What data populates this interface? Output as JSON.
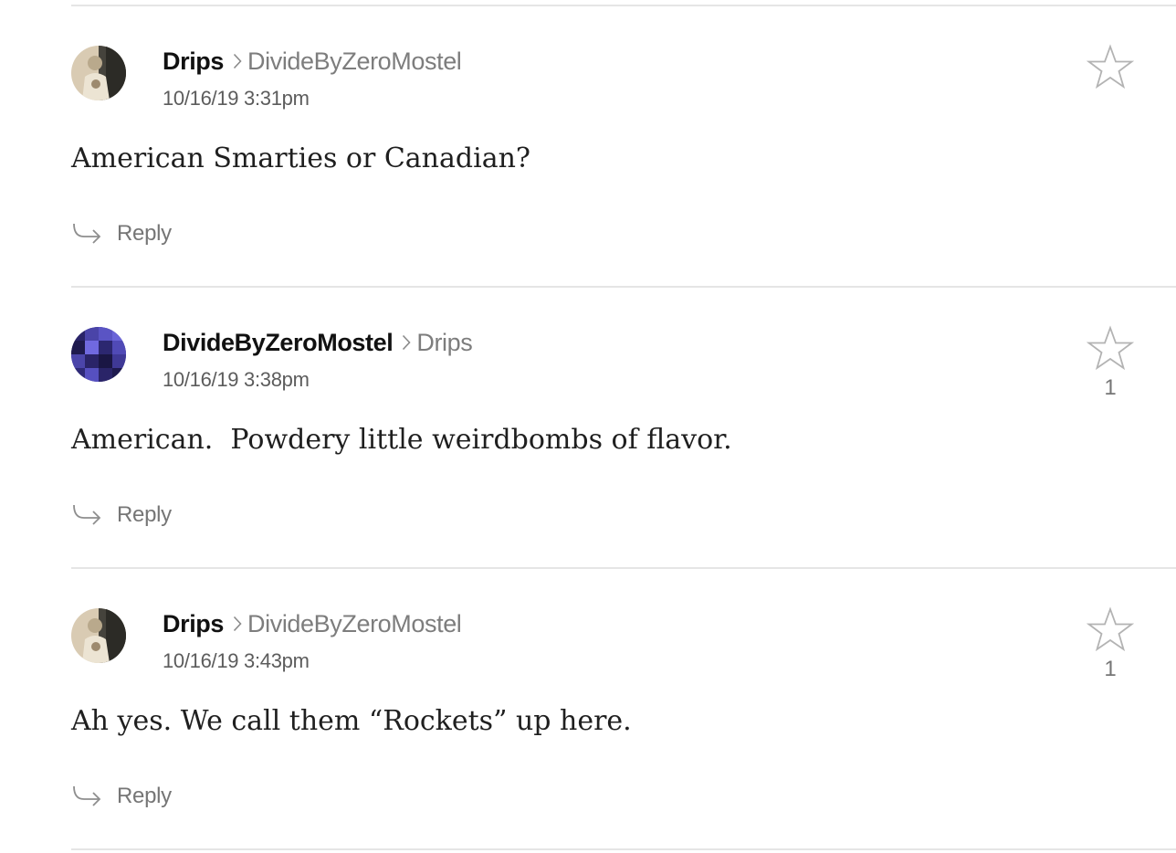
{
  "comments": [
    {
      "author": "Drips",
      "reply_to": "DivideByZeroMostel",
      "timestamp": "10/16/19 3:31pm",
      "body": "American Smarties or Canadian?",
      "reply_label": "Reply",
      "star_count": ""
    },
    {
      "author": "DivideByZeroMostel",
      "reply_to": "Drips",
      "timestamp": "10/16/19 3:38pm",
      "body": "American.  Powdery little weirdbombs of flavor.",
      "reply_label": "Reply",
      "star_count": "1"
    },
    {
      "author": "Drips",
      "reply_to": "DivideByZeroMostel",
      "timestamp": "10/16/19 3:43pm",
      "body": "Ah yes. We call them “Rockets” up here.",
      "reply_label": "Reply",
      "star_count": "1"
    }
  ]
}
